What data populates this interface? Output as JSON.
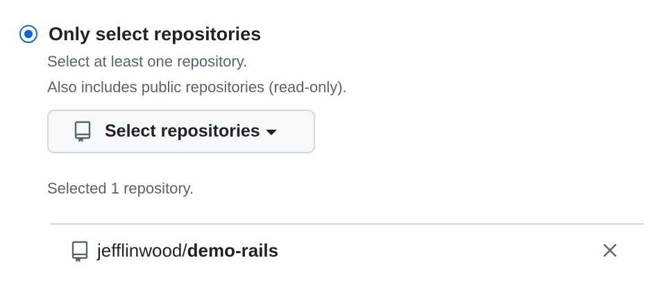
{
  "option": {
    "title": "Only select repositories",
    "selected": true,
    "description_line1": "Select at least one repository.",
    "description_line2": "Also includes public repositories (read-only).",
    "accent_color": "#0969da"
  },
  "select_button": {
    "label": "Select repositories",
    "icon": "repo-icon",
    "caret_icon": "triangle-down-icon"
  },
  "selection": {
    "count_text": "Selected 1 repository.",
    "repositories": [
      {
        "owner": "jefflinwood/",
        "name": "demo-rails",
        "icon": "repo-icon",
        "remove_icon": "close-icon"
      }
    ]
  }
}
